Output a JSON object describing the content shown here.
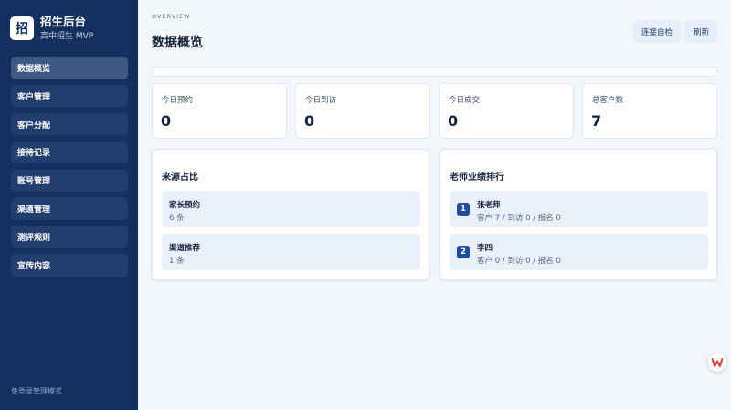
{
  "sidebar": {
    "logo_char": "招",
    "title": "招生后台",
    "subtitle": "高中招生 MVP",
    "items": [
      {
        "label": "数据概览",
        "active": true
      },
      {
        "label": "客户管理"
      },
      {
        "label": "客户分配"
      },
      {
        "label": "接待记录"
      },
      {
        "label": "账号管理"
      },
      {
        "label": "渠道管理"
      },
      {
        "label": "测评规则"
      },
      {
        "label": "宣传内容"
      }
    ],
    "footer": "免登录管理模式"
  },
  "header": {
    "eyebrow": "OVERVIEW",
    "title": "数据概览",
    "check_label": "连接自检",
    "refresh_label": "刷新"
  },
  "stats": [
    {
      "label": "今日预约",
      "value": "0"
    },
    {
      "label": "今日到访",
      "value": "0"
    },
    {
      "label": "今日成交",
      "value": "0"
    },
    {
      "label": "总客户数",
      "value": "7"
    }
  ],
  "sources": {
    "title": "来源占比",
    "items": [
      {
        "name": "家长预约",
        "count": "6 条"
      },
      {
        "name": "渠道推荐",
        "count": "1 条"
      }
    ]
  },
  "ranking": {
    "title": "老师业绩排行",
    "items": [
      {
        "rank": "1",
        "name": "张老师",
        "detail": "客户 7 / 到访 0 / 报名 0"
      },
      {
        "rank": "2",
        "name": "李四",
        "detail": "客户 0 / 到访 0 / 报名 0"
      }
    ]
  },
  "floating": {
    "icon": "wps-logo-icon"
  },
  "colors": {
    "sidebar": "#14305f",
    "accent": "#1d4e9c",
    "background": "#f3f6fb",
    "float_icon": "#e53935"
  }
}
